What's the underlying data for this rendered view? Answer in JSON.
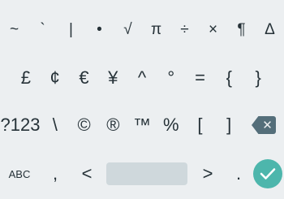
{
  "keyboard": {
    "row1": [
      "~",
      "`",
      "|",
      "•",
      "√",
      "π",
      "÷",
      "×",
      "¶",
      "Δ"
    ],
    "row2": [
      "£",
      "¢",
      "€",
      "¥",
      "^",
      "°",
      "=",
      "{",
      "}"
    ],
    "row3": {
      "mode_key": "?123",
      "symbols": [
        "\\",
        "©",
        "®",
        "™",
        "%",
        "[",
        "]"
      ]
    },
    "row4": {
      "abc_key": "ABC",
      "comma": ",",
      "left": "<",
      "right": ">",
      "period": "."
    }
  },
  "icons": {
    "backspace": "backspace-icon",
    "enter": "check-icon"
  },
  "colors": {
    "background": "#eceff1",
    "key_text": "#263238",
    "spacebar": "#cfd8dc",
    "accent": "#4db6ac",
    "backspace": "#546e7a"
  }
}
